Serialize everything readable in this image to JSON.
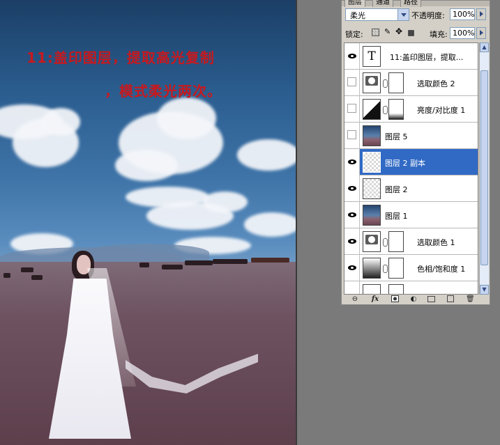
{
  "canvas": {
    "annotation_line1": "11:盖印图层，提取高光复制",
    "annotation_line2": "，模式柔光两次。"
  },
  "panel": {
    "tabs": [
      "图层",
      "通道",
      "路径"
    ],
    "blend_mode": "柔光",
    "opacity_label": "不透明度:",
    "opacity_value": "100%",
    "lock_label": "锁定:",
    "fill_label": "填充:",
    "fill_value": "100%",
    "layers": [
      {
        "name": "11:盖印图层，提取...",
        "visible": true,
        "thumb": "text-icon",
        "thumb_text": "T",
        "mask": false,
        "selected": false
      },
      {
        "name": "选取颜色 2",
        "visible": false,
        "thumb": "selective-color-icon",
        "mask": true,
        "selected": false
      },
      {
        "name": "亮度/对比度 1",
        "visible": false,
        "thumb": "brightness-contrast-icon",
        "mask": true,
        "selected": false
      },
      {
        "name": "图层 5",
        "visible": false,
        "thumb": "photo-thumbnail",
        "mask": false,
        "selected": false
      },
      {
        "name": "图层 2 副本",
        "visible": true,
        "thumb": "transparent-thumbnail",
        "mask": false,
        "selected": true
      },
      {
        "name": "图层 2",
        "visible": true,
        "thumb": "transparent-thumbnail",
        "mask": false,
        "selected": false
      },
      {
        "name": "图层 1",
        "visible": true,
        "thumb": "photo-thumbnail",
        "mask": false,
        "selected": false
      },
      {
        "name": "选取颜色 1",
        "visible": true,
        "thumb": "selective-color-icon",
        "mask": true,
        "selected": false
      },
      {
        "name": "色相/饱和度 1",
        "visible": true,
        "thumb": "hue-saturation-icon",
        "mask": true,
        "selected": false
      }
    ],
    "bottom_icons": [
      "link-icon",
      "fx-icon",
      "mask-icon",
      "adjustment-icon",
      "folder-icon",
      "new-layer-icon",
      "trash-icon"
    ],
    "bottom_fx_label": "fx"
  },
  "colors": {
    "annotation": "#c8191e",
    "selection": "#316ac5"
  }
}
